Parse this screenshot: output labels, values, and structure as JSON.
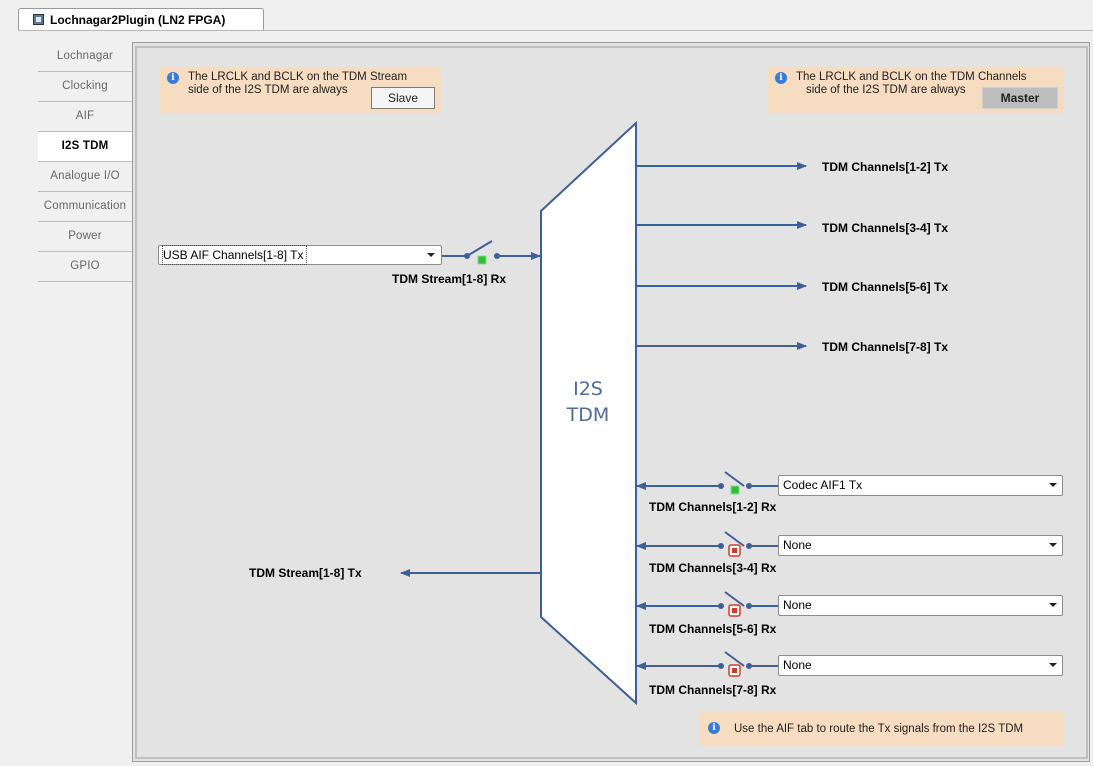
{
  "window": {
    "tab_title": "Lochnagar2Plugin (LN2 FPGA)"
  },
  "nav": {
    "items": [
      {
        "label": "Lochnagar",
        "active": false
      },
      {
        "label": "Clocking",
        "active": false
      },
      {
        "label": "AIF",
        "active": false
      },
      {
        "label": "I2S TDM",
        "active": true
      },
      {
        "label": "Analogue I/O",
        "active": false
      },
      {
        "label": "Communication",
        "active": false
      },
      {
        "label": "Power",
        "active": false
      },
      {
        "label": "GPIO",
        "active": false
      }
    ]
  },
  "notes": {
    "stream_side": {
      "line1": "The LRCLK and BCLK on the TDM Stream",
      "line2": "side of the I2S TDM are always",
      "mode": "Slave"
    },
    "channels_side": {
      "line1": "The LRCLK and BCLK on the TDM Channels",
      "line2": "side of the I2S TDM are always",
      "mode": "Master"
    },
    "footer": "Use the AIF tab to route the Tx signals from the I2S TDM"
  },
  "block": {
    "line1": "I2S",
    "line2": "TDM"
  },
  "stream_rx": {
    "source": "USB AIF Channels[1-8] Tx",
    "label": "TDM Stream[1-8] Rx",
    "switch_state": "on"
  },
  "stream_tx": {
    "label": "TDM Stream[1-8] Tx"
  },
  "tx_outputs": [
    "TDM Channels[1-2] Tx",
    "TDM Channels[3-4] Tx",
    "TDM Channels[5-6] Tx",
    "TDM Channels[7-8] Tx"
  ],
  "rx_inputs": [
    {
      "label": "TDM Channels[1-2] Rx",
      "source": "Codec AIF1 Tx",
      "switch_state": "on"
    },
    {
      "label": "TDM Channels[3-4] Rx",
      "source": "None",
      "switch_state": "off"
    },
    {
      "label": "TDM Channels[5-6] Rx",
      "source": "None",
      "switch_state": "off"
    },
    {
      "label": "TDM Channels[7-8] Rx",
      "source": "None",
      "switch_state": "off"
    }
  ],
  "colors": {
    "accent": "#3f5f97",
    "block_text": "#4d6d99",
    "note_bg": "#f6dcc0",
    "led_on": "#2fbf3a",
    "led_off": "#d33a2a"
  }
}
